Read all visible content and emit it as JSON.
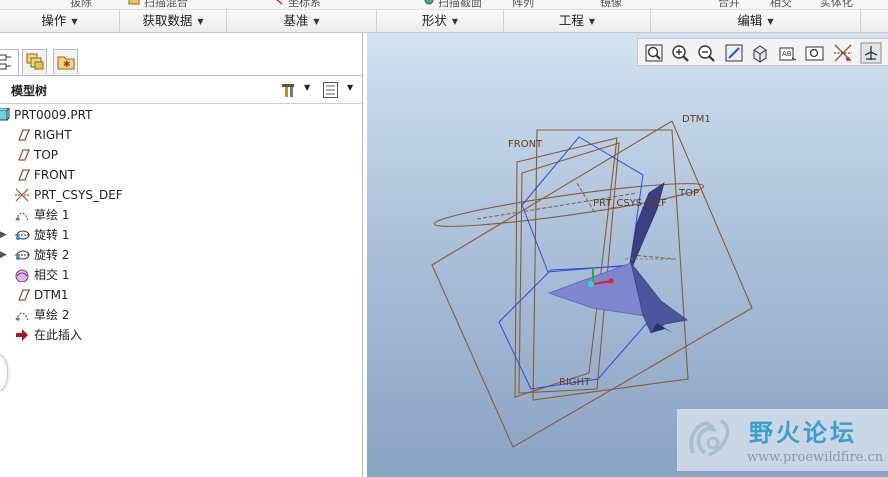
{
  "ribbon": {
    "top_strip_items": [
      {
        "label": "拔除",
        "icon": "extrude-icon"
      },
      {
        "label": "扫描混合",
        "icon": "sweep-blend-icon"
      },
      {
        "label": "坐标系",
        "icon": "csys-icon"
      },
      {
        "label": "扫描截面",
        "icon": "sweep-icon"
      },
      {
        "label": "阵列",
        "icon": "pattern-icon"
      },
      {
        "label": "镜像",
        "icon": "mirror-icon"
      },
      {
        "label": "合并",
        "icon": "merge-icon"
      },
      {
        "label": "相交",
        "icon": "intersect-icon"
      },
      {
        "label": "实体化",
        "icon": "solidify-icon"
      }
    ],
    "groups": [
      "操作",
      "获取数据",
      "基准",
      "形状",
      "工程",
      "编辑"
    ]
  },
  "panel": {
    "tabs": [
      "model-tree-tab-icon",
      "layer-tree-tab-icon",
      "favorites-tab-icon"
    ],
    "tree_title": "模型树",
    "settings_icon": "tools-icon",
    "show_icon": "tree-columns-icon"
  },
  "tree": {
    "items": [
      {
        "label": "PRT0009.PRT",
        "icon": "part-icon",
        "expandable": false
      },
      {
        "label": "RIGHT",
        "icon": "datum-plane-icon",
        "expandable": false
      },
      {
        "label": "TOP",
        "icon": "datum-plane-icon",
        "expandable": false
      },
      {
        "label": "FRONT",
        "icon": "datum-plane-icon",
        "expandable": false
      },
      {
        "label": "PRT_CSYS_DEF",
        "icon": "coordinate-system-icon",
        "expandable": false
      },
      {
        "label": "草绘 1",
        "icon": "sketch-icon",
        "expandable": false
      },
      {
        "label": "旋转 1",
        "icon": "revolve-icon",
        "expandable": true
      },
      {
        "label": "旋转 2",
        "icon": "revolve-icon",
        "expandable": true
      },
      {
        "label": "相交 1",
        "icon": "intersect-icon",
        "expandable": false
      },
      {
        "label": "DTM1",
        "icon": "datum-plane-icon",
        "expandable": false
      },
      {
        "label": "草绘 2",
        "icon": "sketch-icon",
        "expandable": false
      },
      {
        "label": "在此插入",
        "icon": "insert-here-arrow-icon",
        "expandable": false
      }
    ]
  },
  "viewport": {
    "toolbar_icons": [
      "refit-icon",
      "zoom-in-icon",
      "zoom-out-icon",
      "repaint-icon",
      "display-style-icon",
      "saved-views-icon",
      "view-manager-icon",
      "datum-display-icon",
      "spin-center-icon"
    ],
    "datum_labels": {
      "dtm1": "DTM1",
      "front": "FRONT",
      "top": "TOP",
      "csys": "PRT_CSYS_DEF",
      "right": "RIGHT"
    },
    "colors": {
      "datum": "#8a5a34",
      "sketch": "#2f4ce0",
      "surface": "#7f86cf",
      "background_top": "#d3e2f0",
      "background_bottom": "#8aa3c3"
    }
  },
  "watermark": {
    "title": "野火论坛",
    "url": "www.proewildfire.cn",
    "logo_icon": "wildfire-logo-icon"
  }
}
